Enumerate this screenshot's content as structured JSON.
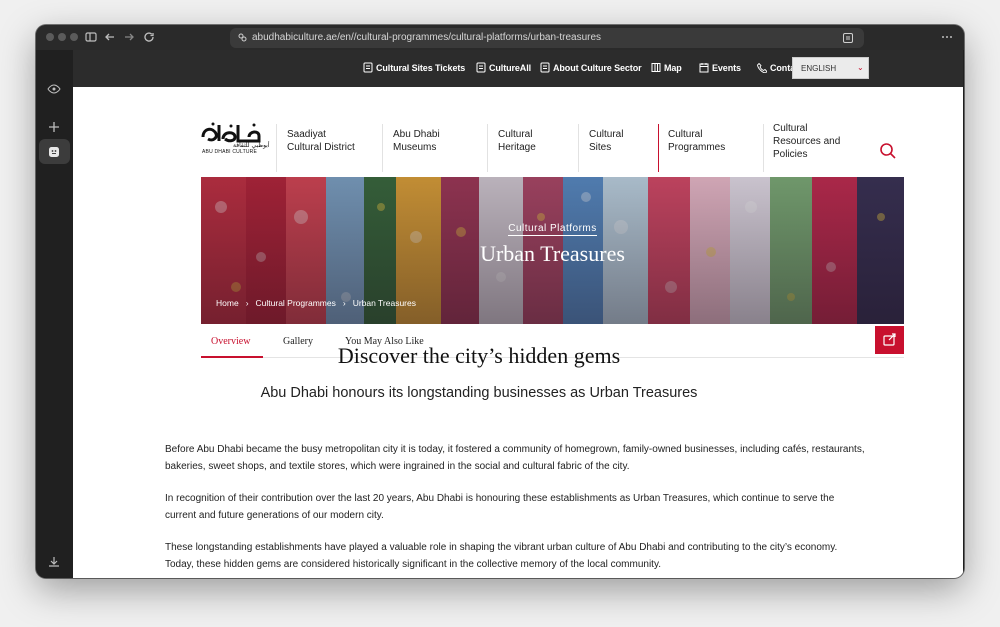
{
  "browser": {
    "url": "abudhabiculture.ae/en//cultural-programmes/cultural-platforms/urban-treasures"
  },
  "utility_bar": {
    "items": [
      {
        "label": "Cultural Sites Tickets",
        "icon": "ticket-icon"
      },
      {
        "label": "CultureAll",
        "icon": "document-icon"
      },
      {
        "label": "About Culture Sector",
        "icon": "document-icon"
      },
      {
        "label": "Map",
        "icon": "map-icon"
      },
      {
        "label": "Events",
        "icon": "calendar-icon"
      },
      {
        "label": "Contact Us",
        "icon": "phone-icon"
      }
    ],
    "language": "ENGLISH"
  },
  "logo": {
    "english": "ABU DHABI CULTURE",
    "arabic": "أبوظبي للثقافة"
  },
  "nav": [
    {
      "line1": "Saadiyat",
      "line2": "Cultural District",
      "line3": ""
    },
    {
      "line1": "Abu Dhabi",
      "line2": "Museums",
      "line3": ""
    },
    {
      "line1": "Cultural",
      "line2": "Heritage",
      "line3": ""
    },
    {
      "line1": "Cultural",
      "line2": "Sites",
      "line3": ""
    },
    {
      "line1": "Cultural",
      "line2": "Programmes",
      "line3": ""
    },
    {
      "line1": "Cultural",
      "line2": "Resources and",
      "line3": "Policies"
    }
  ],
  "hero": {
    "subtitle": "Cultural Platforms",
    "title": "Urban Treasures",
    "breadcrumb": [
      "Home",
      "Cultural Programmes",
      "Urban Treasures"
    ]
  },
  "tabs": [
    "Overview",
    "Gallery",
    "You May Also Like"
  ],
  "article": {
    "heading": "Discover the city’s hidden gems",
    "subheading": "Abu Dhabi honours its longstanding businesses as Urban Treasures",
    "paragraphs": [
      "Before Abu Dhabi became the busy metropolitan city it is today, it fostered a community of homegrown, family-owned businesses, including cafés, restaurants, bakeries, sweet shops, and textile stores, which were ingrained in the social and cultural fabric of the city.",
      "In recognition of their contribution over the last 20 years, Abu Dhabi is honouring these establishments as Urban Treasures, which continue to serve the current and future generations of our modern city.",
      "These longstanding establishments have played a valuable role in shaping the vibrant urban culture of Abu Dhabi and contributing to the city’s economy. Today, these hidden gems are considered historically significant in the collective memory of the local community."
    ]
  },
  "colors": {
    "accent": "#c8102e",
    "utility_bar": "#2c2c2c"
  }
}
